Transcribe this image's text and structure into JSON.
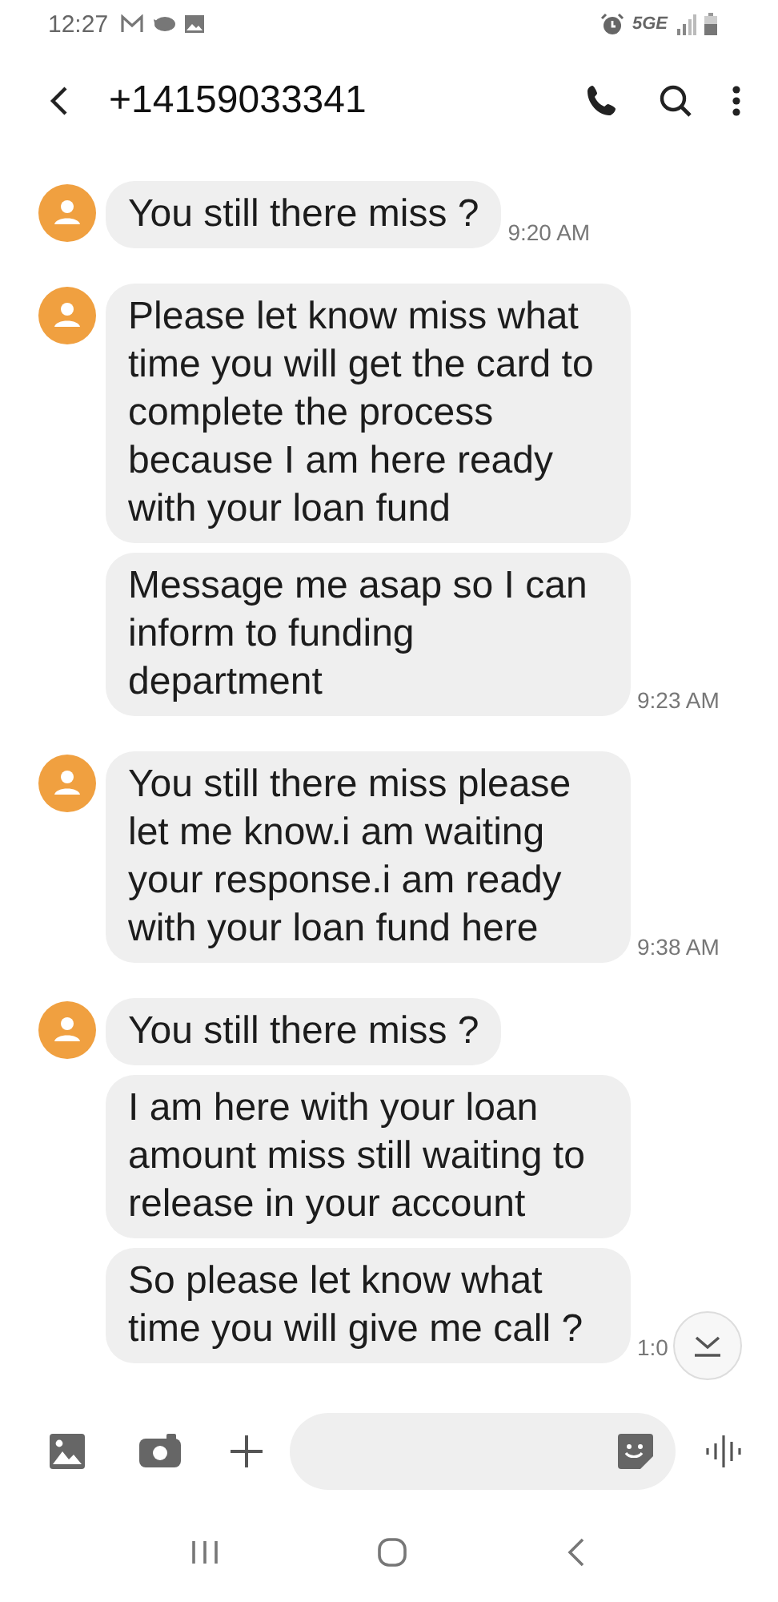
{
  "status_bar": {
    "time": "12:27",
    "network": "5GE"
  },
  "header": {
    "title": "+14159033341"
  },
  "groups": [
    {
      "messages": [
        "You still there miss ?"
      ],
      "time": "9:20 AM"
    },
    {
      "messages": [
        "Please let know miss what time you will get the card to complete the process because I am here ready with your loan fund",
        "Message me asap so I can inform to funding department"
      ],
      "time": "9:23 AM"
    },
    {
      "messages": [
        "You still there miss please let me know.i am waiting your response.i am ready with your loan fund here"
      ],
      "time": "9:38 AM"
    },
    {
      "messages": [
        "You still there miss ?",
        "I am here with your loan amount miss still waiting to release in your account",
        "So please let know what time you will give me call ?"
      ],
      "time": "1:0"
    }
  ]
}
